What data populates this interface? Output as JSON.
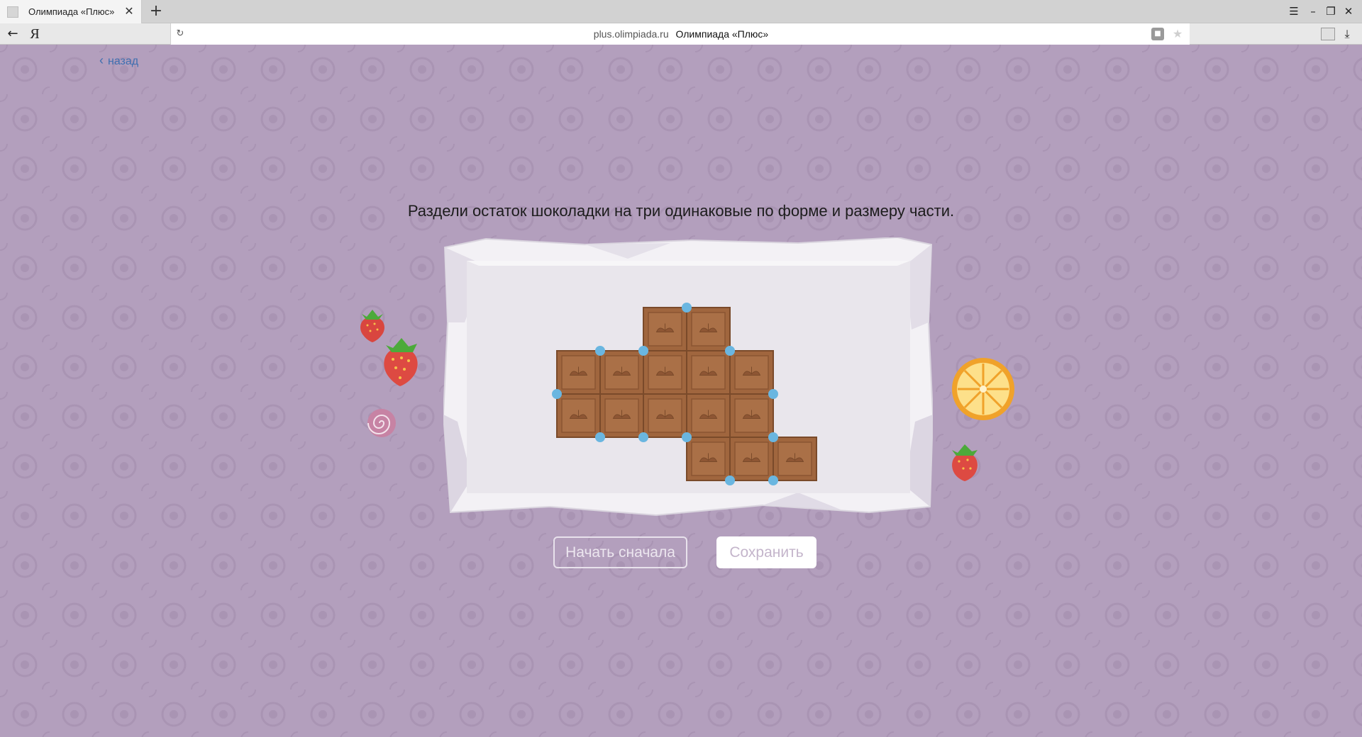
{
  "browser": {
    "tab_title": "Олимпиада «Плюс»",
    "tab_close": "✕",
    "new_tab": "+",
    "url_domain": "plus.olimpiada.ru",
    "url_page_title": "Олимпиада «Плюс»",
    "logo_letter": "Я"
  },
  "page": {
    "back_label": "назад",
    "task": "Раздели остаток шоколадки на три одинаковые по форме и размеру части.",
    "restart_label": "Начать сначала",
    "save_label": "Сохранить"
  },
  "puzzle": {
    "chocolate_cells": [
      [
        2,
        0
      ],
      [
        3,
        0
      ],
      [
        0,
        1
      ],
      [
        1,
        1
      ],
      [
        2,
        1
      ],
      [
        3,
        1
      ],
      [
        4,
        1
      ],
      [
        0,
        2
      ],
      [
        1,
        2
      ],
      [
        2,
        2
      ],
      [
        3,
        2
      ],
      [
        4,
        2
      ],
      [
        3,
        3
      ],
      [
        4,
        3
      ],
      [
        5,
        3
      ]
    ],
    "handle_points": [
      [
        3,
        0
      ],
      [
        1,
        1
      ],
      [
        2,
        1
      ],
      [
        4,
        1
      ],
      [
        0,
        2
      ],
      [
        5,
        2
      ],
      [
        1,
        3
      ],
      [
        2,
        3
      ],
      [
        3,
        3
      ],
      [
        5,
        3
      ],
      [
        4,
        4
      ],
      [
        5,
        4
      ]
    ],
    "colors": {
      "chocolate": "#a0663e",
      "chocolate_dark": "#7a4a2a",
      "handle": "#6ab6e0",
      "wrapper": "#ebe8ee"
    }
  },
  "decorations": [
    "strawberry-small",
    "strawberry-large",
    "candy-swirl",
    "orange-slice",
    "strawberry-right"
  ]
}
